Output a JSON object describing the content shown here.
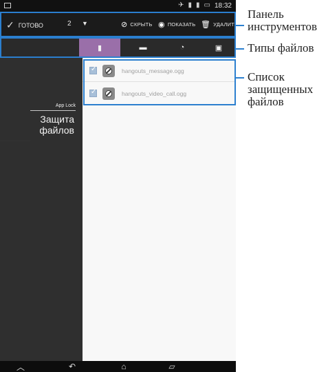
{
  "status_bar": {
    "time": "18:32",
    "icons": [
      "screenshot-icon",
      "notification-icon",
      "signal-icon",
      "battery-icon"
    ]
  },
  "toolbar": {
    "done_label": "ГОТОВО",
    "count": "2",
    "dropdown_symbol": "▼",
    "hide_label": "СКРЫТЬ",
    "show_label": "ПОКАЗАТЬ",
    "delete_label": "УДАЛИТЬ"
  },
  "tabs": [
    {
      "name": "documents-tab",
      "icon": "document-icon",
      "active": true
    },
    {
      "name": "images-tab",
      "icon": "image-icon",
      "active": false
    },
    {
      "name": "music-tab",
      "icon": "music-icon",
      "active": false
    },
    {
      "name": "files-tab",
      "icon": "file-icon",
      "active": false
    }
  ],
  "left_panel": {
    "app_lock": "App Lock",
    "title_line1": "Защита",
    "title_line2": "файлов"
  },
  "files": [
    {
      "name": "hangouts_message.ogg"
    },
    {
      "name": "hangouts_video_call.ogg"
    }
  ],
  "annotations": {
    "toolbar_line1": "Панель",
    "toolbar_line2": "инструментов",
    "tabs_label": "Типы файлов",
    "list_line1": "Список",
    "list_line2": "защищенных",
    "list_line3": "файлов"
  },
  "colors": {
    "accent_active_tab": "#9a6fa9",
    "annotation_blue": "#2b7fcf"
  }
}
